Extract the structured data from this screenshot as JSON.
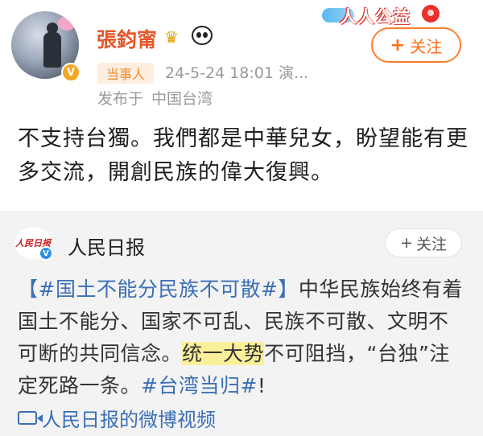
{
  "post": {
    "username": "張鈞甯",
    "crown_icon": "crown-icon",
    "panda_icon": "panda-icon",
    "banner_text": "人人公益",
    "follow_label": "关注",
    "party_badge": "当事人",
    "timestamp": "24-5-24 18:01",
    "source_suffix": "演...",
    "location_prefix": "发布于",
    "location": "中国台湾",
    "text": "不支持台獨。我們都是中華兒女，盼望能有更多交流，開創民族的偉大復興。"
  },
  "quote": {
    "account_name": "人民日报",
    "logo_text": "人民日报",
    "follow_label": "关注",
    "segments": [
      {
        "type": "tag",
        "text": "【#国土不能分民族不可散#】"
      },
      {
        "type": "plain",
        "text": "中华民族始终有着国土不能分、国家不可乱、民族不可散、文明不可断的共同信念。"
      },
      {
        "type": "highlight",
        "text": "统一大势"
      },
      {
        "type": "plain",
        "text": "不可阻挡，“台独”注定死路一条。"
      },
      {
        "type": "tag",
        "text": "#台湾当归#"
      },
      {
        "type": "plain",
        "text": "!"
      }
    ],
    "video_link": "人民日报的微博视频"
  },
  "colors": {
    "username": "#e8562a",
    "follow_accent": "#ff6f1c",
    "link_blue": "#3b6fb6",
    "highlight": "#fbf09a"
  }
}
